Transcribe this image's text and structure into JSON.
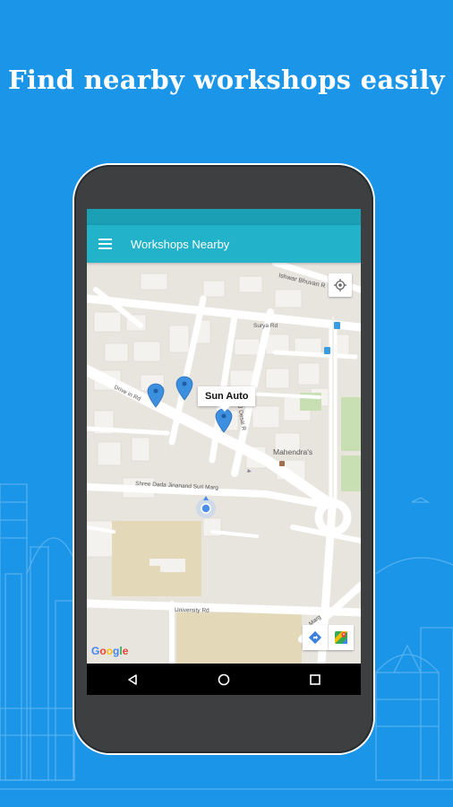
{
  "headline": "Find nearby workshops easily",
  "app_bar": {
    "title": "Workshops Nearby"
  },
  "map": {
    "streets": [
      "Ishwar Bhuvan R",
      "Surya Rd",
      "Drive in Rd",
      "NJ Desai R",
      "Shree Dada Jinanand Suri Marg",
      "University Rd",
      "Marg"
    ],
    "poi": "Mahendra's",
    "selected_marker_label": "Sun Auto",
    "attribution": "Google"
  },
  "colors": {
    "background": "#1b95e8",
    "app_bar": "#22b2c9",
    "status_bar": "#1a9fb5",
    "marker": "#3d8fe0"
  }
}
